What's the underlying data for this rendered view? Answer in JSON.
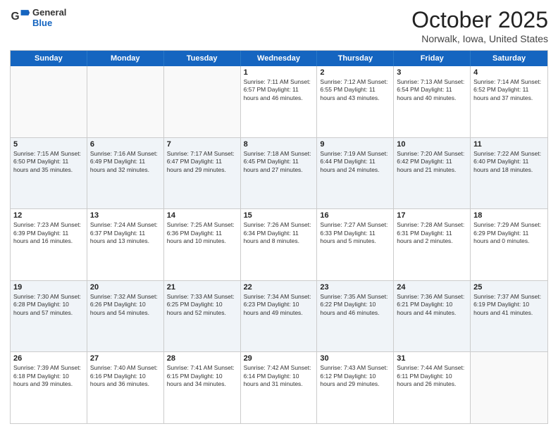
{
  "header": {
    "logo_general": "General",
    "logo_blue": "Blue",
    "month_title": "October 2025",
    "location": "Norwalk, Iowa, United States"
  },
  "weekdays": [
    "Sunday",
    "Monday",
    "Tuesday",
    "Wednesday",
    "Thursday",
    "Friday",
    "Saturday"
  ],
  "rows": [
    {
      "alt": false,
      "cells": [
        {
          "day": "",
          "text": ""
        },
        {
          "day": "",
          "text": ""
        },
        {
          "day": "",
          "text": ""
        },
        {
          "day": "1",
          "text": "Sunrise: 7:11 AM\nSunset: 6:57 PM\nDaylight: 11 hours and 46 minutes."
        },
        {
          "day": "2",
          "text": "Sunrise: 7:12 AM\nSunset: 6:55 PM\nDaylight: 11 hours and 43 minutes."
        },
        {
          "day": "3",
          "text": "Sunrise: 7:13 AM\nSunset: 6:54 PM\nDaylight: 11 hours and 40 minutes."
        },
        {
          "day": "4",
          "text": "Sunrise: 7:14 AM\nSunset: 6:52 PM\nDaylight: 11 hours and 37 minutes."
        }
      ]
    },
    {
      "alt": true,
      "cells": [
        {
          "day": "5",
          "text": "Sunrise: 7:15 AM\nSunset: 6:50 PM\nDaylight: 11 hours and 35 minutes."
        },
        {
          "day": "6",
          "text": "Sunrise: 7:16 AM\nSunset: 6:49 PM\nDaylight: 11 hours and 32 minutes."
        },
        {
          "day": "7",
          "text": "Sunrise: 7:17 AM\nSunset: 6:47 PM\nDaylight: 11 hours and 29 minutes."
        },
        {
          "day": "8",
          "text": "Sunrise: 7:18 AM\nSunset: 6:45 PM\nDaylight: 11 hours and 27 minutes."
        },
        {
          "day": "9",
          "text": "Sunrise: 7:19 AM\nSunset: 6:44 PM\nDaylight: 11 hours and 24 minutes."
        },
        {
          "day": "10",
          "text": "Sunrise: 7:20 AM\nSunset: 6:42 PM\nDaylight: 11 hours and 21 minutes."
        },
        {
          "day": "11",
          "text": "Sunrise: 7:22 AM\nSunset: 6:40 PM\nDaylight: 11 hours and 18 minutes."
        }
      ]
    },
    {
      "alt": false,
      "cells": [
        {
          "day": "12",
          "text": "Sunrise: 7:23 AM\nSunset: 6:39 PM\nDaylight: 11 hours and 16 minutes."
        },
        {
          "day": "13",
          "text": "Sunrise: 7:24 AM\nSunset: 6:37 PM\nDaylight: 11 hours and 13 minutes."
        },
        {
          "day": "14",
          "text": "Sunrise: 7:25 AM\nSunset: 6:36 PM\nDaylight: 11 hours and 10 minutes."
        },
        {
          "day": "15",
          "text": "Sunrise: 7:26 AM\nSunset: 6:34 PM\nDaylight: 11 hours and 8 minutes."
        },
        {
          "day": "16",
          "text": "Sunrise: 7:27 AM\nSunset: 6:33 PM\nDaylight: 11 hours and 5 minutes."
        },
        {
          "day": "17",
          "text": "Sunrise: 7:28 AM\nSunset: 6:31 PM\nDaylight: 11 hours and 2 minutes."
        },
        {
          "day": "18",
          "text": "Sunrise: 7:29 AM\nSunset: 6:29 PM\nDaylight: 11 hours and 0 minutes."
        }
      ]
    },
    {
      "alt": true,
      "cells": [
        {
          "day": "19",
          "text": "Sunrise: 7:30 AM\nSunset: 6:28 PM\nDaylight: 10 hours and 57 minutes."
        },
        {
          "day": "20",
          "text": "Sunrise: 7:32 AM\nSunset: 6:26 PM\nDaylight: 10 hours and 54 minutes."
        },
        {
          "day": "21",
          "text": "Sunrise: 7:33 AM\nSunset: 6:25 PM\nDaylight: 10 hours and 52 minutes."
        },
        {
          "day": "22",
          "text": "Sunrise: 7:34 AM\nSunset: 6:23 PM\nDaylight: 10 hours and 49 minutes."
        },
        {
          "day": "23",
          "text": "Sunrise: 7:35 AM\nSunset: 6:22 PM\nDaylight: 10 hours and 46 minutes."
        },
        {
          "day": "24",
          "text": "Sunrise: 7:36 AM\nSunset: 6:21 PM\nDaylight: 10 hours and 44 minutes."
        },
        {
          "day": "25",
          "text": "Sunrise: 7:37 AM\nSunset: 6:19 PM\nDaylight: 10 hours and 41 minutes."
        }
      ]
    },
    {
      "alt": false,
      "cells": [
        {
          "day": "26",
          "text": "Sunrise: 7:39 AM\nSunset: 6:18 PM\nDaylight: 10 hours and 39 minutes."
        },
        {
          "day": "27",
          "text": "Sunrise: 7:40 AM\nSunset: 6:16 PM\nDaylight: 10 hours and 36 minutes."
        },
        {
          "day": "28",
          "text": "Sunrise: 7:41 AM\nSunset: 6:15 PM\nDaylight: 10 hours and 34 minutes."
        },
        {
          "day": "29",
          "text": "Sunrise: 7:42 AM\nSunset: 6:14 PM\nDaylight: 10 hours and 31 minutes."
        },
        {
          "day": "30",
          "text": "Sunrise: 7:43 AM\nSunset: 6:12 PM\nDaylight: 10 hours and 29 minutes."
        },
        {
          "day": "31",
          "text": "Sunrise: 7:44 AM\nSunset: 6:11 PM\nDaylight: 10 hours and 26 minutes."
        },
        {
          "day": "",
          "text": ""
        }
      ]
    }
  ]
}
